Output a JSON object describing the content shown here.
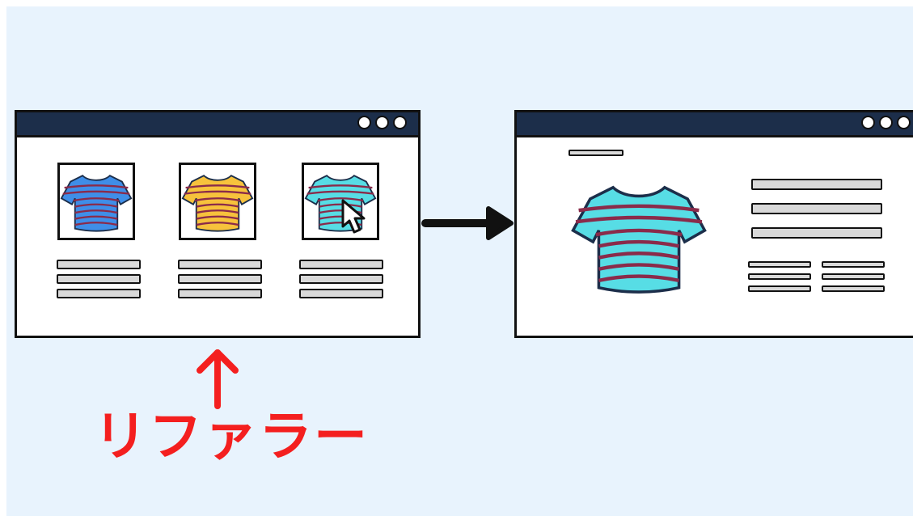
{
  "annotation": {
    "label": "リファラー",
    "color": "#f41f1f"
  },
  "colors": {
    "background": "#e8f3fd",
    "titlebar": "#1c2e4a",
    "placeholder_bar": "#d9d9d9",
    "shirt_blue": "#3f8ee8",
    "shirt_yellow": "#f7c23c",
    "shirt_cyan": "#57dde5",
    "shirt_stripe": "#8a2b4a"
  },
  "list_page": {
    "products": [
      {
        "icon": "blue-striped-tshirt-icon"
      },
      {
        "icon": "yellow-striped-tshirt-icon"
      },
      {
        "icon": "cyan-striped-tshirt-icon",
        "cursor": "mouse-pointer-icon"
      }
    ]
  },
  "detail_page": {
    "icon": "cyan-striped-tshirt-icon"
  },
  "icons": {
    "flow_arrow": "arrow-right-icon",
    "annotation_arrow": "arrow-up-icon"
  }
}
